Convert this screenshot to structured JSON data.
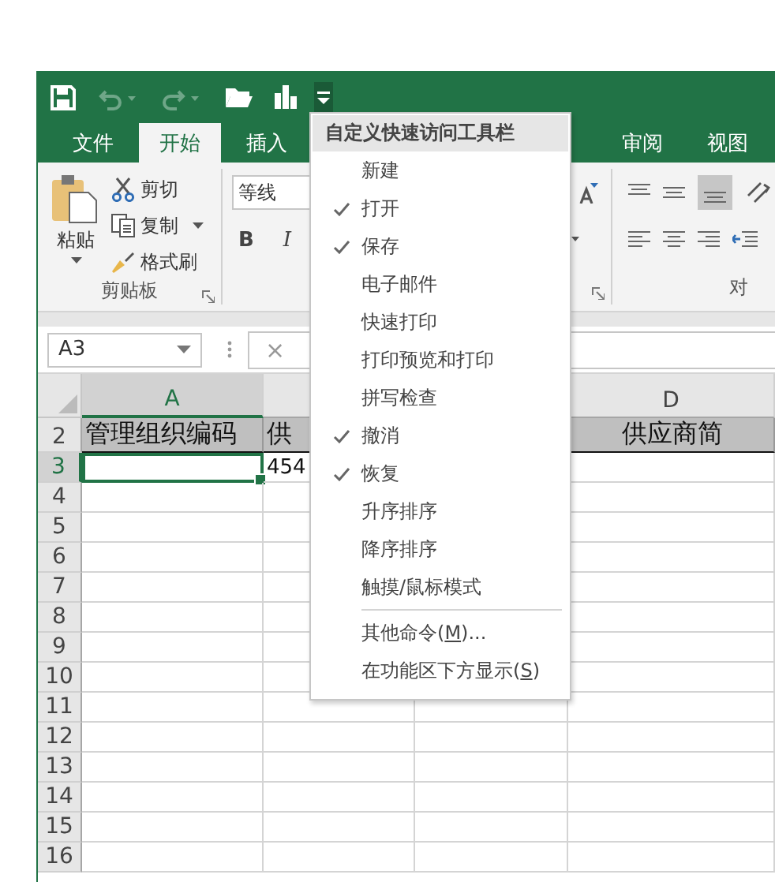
{
  "tabs": [
    {
      "label": "文件",
      "selected": false
    },
    {
      "label": "开始",
      "selected": true
    },
    {
      "label": "插入",
      "selected": false
    },
    {
      "label": "审阅",
      "selected": false
    },
    {
      "label": "视图",
      "selected": false
    }
  ],
  "clipboard_group": {
    "paste": "粘贴",
    "cut": "剪切",
    "copy": "复制",
    "format_painter": "格式刷",
    "label": "剪贴板"
  },
  "font_group": {
    "font_name": "等线",
    "bold": "B",
    "italic": "I"
  },
  "alignment_group": {
    "label": "对"
  },
  "formula_bar": {
    "name_box": "A3",
    "cancel": "×"
  },
  "column_headers": [
    {
      "label": "A",
      "selected": true
    },
    {
      "label": "D",
      "selected": false
    }
  ],
  "rows": [
    {
      "number": "2",
      "kind": "header",
      "cells": [
        {
          "text": "管理组织编码",
          "selected": false
        },
        {
          "text": "供",
          "selected": false
        },
        {},
        {
          "text": "供应商简",
          "selected": false
        }
      ]
    },
    {
      "number": "3",
      "kind": "data",
      "cells": [
        {
          "selected": true
        },
        {
          "text": "454",
          "selected": false
        },
        {},
        {
          "selected": false
        }
      ]
    },
    {
      "number": "4",
      "kind": "data"
    },
    {
      "number": "5",
      "kind": "data"
    },
    {
      "number": "6",
      "kind": "data"
    },
    {
      "number": "7",
      "kind": "data"
    },
    {
      "number": "8",
      "kind": "data"
    },
    {
      "number": "9",
      "kind": "data"
    },
    {
      "number": "10",
      "kind": "data"
    },
    {
      "number": "11",
      "kind": "data"
    },
    {
      "number": "12",
      "kind": "data"
    },
    {
      "number": "13",
      "kind": "data"
    },
    {
      "number": "14",
      "kind": "data"
    },
    {
      "number": "15",
      "kind": "data"
    },
    {
      "number": "16",
      "kind": "data"
    }
  ],
  "quick_access_menu": {
    "title": "自定义快速访问工具栏",
    "items": [
      {
        "label": "新建",
        "checked": false
      },
      {
        "label": "打开",
        "checked": true
      },
      {
        "label": "保存",
        "checked": true
      },
      {
        "label": "电子邮件",
        "checked": false
      },
      {
        "label": "快速打印",
        "checked": false
      },
      {
        "label": "打印预览和打印",
        "checked": false
      },
      {
        "label": "拼写检查",
        "checked": false
      },
      {
        "label": "撤消",
        "checked": true
      },
      {
        "label": "恢复",
        "checked": true
      },
      {
        "label": "升序排序",
        "checked": false
      },
      {
        "label": "降序排序",
        "checked": false
      },
      {
        "label": "触摸/鼠标模式",
        "checked": false
      }
    ],
    "commands": [
      {
        "before": "其他命令(",
        "access_key": "M",
        "after": ")..."
      },
      {
        "before": "在功能区下方显示(",
        "access_key": "S",
        "after": ")"
      }
    ]
  }
}
